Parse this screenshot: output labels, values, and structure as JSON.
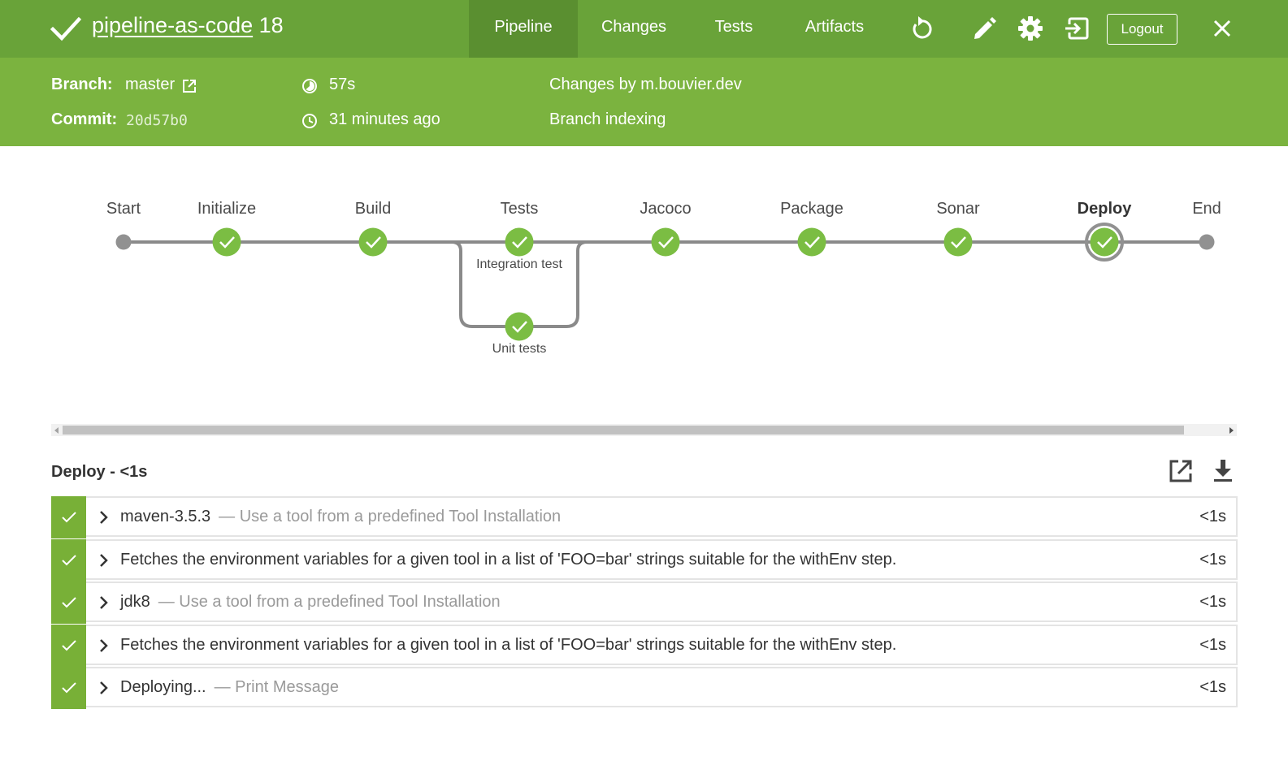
{
  "header": {
    "job_name": "pipeline-as-code",
    "run_number": "18",
    "tabs": [
      {
        "label": "Pipeline",
        "active": true
      },
      {
        "label": "Changes",
        "active": false
      },
      {
        "label": "Tests",
        "active": false
      },
      {
        "label": "Artifacts",
        "active": false
      }
    ],
    "icons": [
      "replay-icon",
      "edit-icon",
      "settings-icon",
      "exit-icon",
      "close-icon"
    ],
    "logout_label": "Logout",
    "background_color": "#69a339"
  },
  "summary": {
    "branch_label": "Branch:",
    "branch_value": "master",
    "commit_label": "Commit:",
    "commit_value": "20d57b0",
    "duration": "57s",
    "started": "31 minutes ago",
    "changes_by": "Changes by m.bouvier.dev",
    "cause": "Branch indexing",
    "background_color": "#7bb33f"
  },
  "pipeline": {
    "stages": [
      {
        "label": "Start",
        "type": "terminal"
      },
      {
        "label": "Initialize",
        "status": "success"
      },
      {
        "label": "Build",
        "status": "success"
      },
      {
        "label": "Tests",
        "status": "success",
        "parallel": [
          "Integration test",
          "Unit tests"
        ]
      },
      {
        "label": "Jacoco",
        "status": "success"
      },
      {
        "label": "Package",
        "status": "success"
      },
      {
        "label": "Sonar",
        "status": "success"
      },
      {
        "label": "Deploy",
        "status": "success",
        "selected": true
      },
      {
        "label": "End",
        "type": "terminal"
      }
    ],
    "success_color": "#7bbd43",
    "line_color": "#8a8a8a"
  },
  "steps_panel": {
    "title": "Deploy - <1s",
    "icons": [
      "open-external-icon",
      "download-icon"
    ],
    "steps": [
      {
        "name": "maven-3.5.3",
        "description": "— Use a tool from a predefined Tool Installation",
        "duration": "<1s"
      },
      {
        "name": "Fetches the environment variables for a given tool in a list of 'FOO=bar' strings suitable for the withEnv step.",
        "description": "",
        "duration": "<1s"
      },
      {
        "name": "jdk8",
        "description": "— Use a tool from a predefined Tool Installation",
        "duration": "<1s"
      },
      {
        "name": "Fetches the environment variables for a given tool in a list of 'FOO=bar' strings suitable for the withEnv step.",
        "description": "",
        "duration": "<1s"
      },
      {
        "name": "Deploying...",
        "description": "— Print Message",
        "duration": "<1s"
      }
    ]
  }
}
